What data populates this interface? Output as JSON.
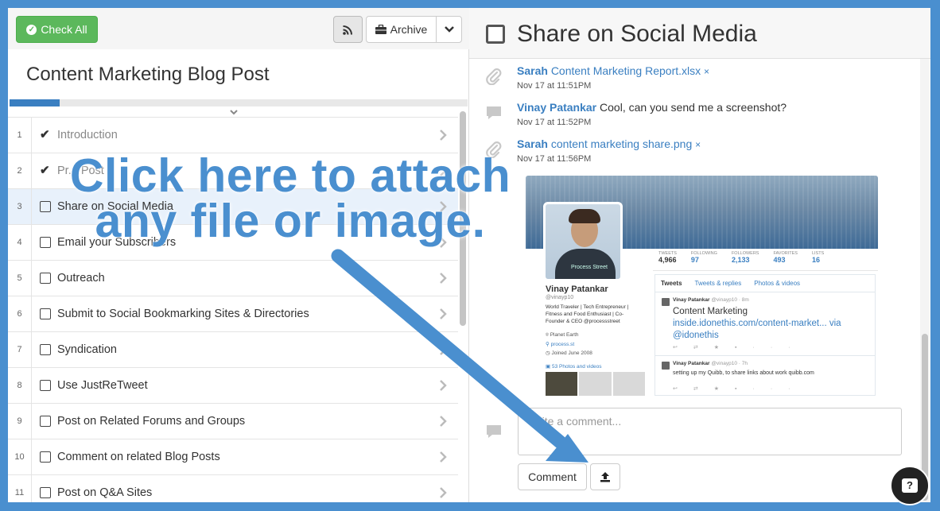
{
  "toolbar": {
    "check_all_label": "Check All",
    "archive_label": "Archive"
  },
  "checklist": {
    "title": "Content Marketing Blog Post",
    "progress": 0.11,
    "tasks": [
      {
        "num": "1",
        "label": "Introduction",
        "done": true
      },
      {
        "num": "2",
        "label": "Pr... Post",
        "done": true
      },
      {
        "num": "3",
        "label": "Share on Social Media",
        "done": false
      },
      {
        "num": "4",
        "label": "Email your Subscribers",
        "done": false
      },
      {
        "num": "5",
        "label": "Outreach",
        "done": false
      },
      {
        "num": "6",
        "label": "Submit to Social Bookmarking Sites & Directories",
        "done": false
      },
      {
        "num": "7",
        "label": "Syndication",
        "done": false
      },
      {
        "num": "8",
        "label": "Use JustReTweet",
        "done": false
      },
      {
        "num": "9",
        "label": "Post on Related Forums and Groups",
        "done": false
      },
      {
        "num": "10",
        "label": "Comment on related Blog Posts",
        "done": false
      },
      {
        "num": "11",
        "label": "Post on Q&A Sites",
        "done": false
      }
    ]
  },
  "task_detail": {
    "title": "Share on Social Media",
    "feed": [
      {
        "type": "attachment",
        "author": "Sarah",
        "text": "Content Marketing Report.xlsx",
        "remove": "×",
        "time": "Nov 17 at 11:51PM"
      },
      {
        "type": "comment",
        "author": "Vinay Patankar",
        "text": "Cool, can you send me a screenshot?",
        "time": "Nov 17 at 11:52PM"
      },
      {
        "type": "attachment",
        "author": "Sarah",
        "text": "content marketing share.png",
        "remove": "×",
        "time": "Nov 17 at 11:56PM"
      }
    ],
    "comment_placeholder": "Write a comment...",
    "comment_button": "Comment"
  },
  "preview": {
    "stats": [
      {
        "label": "TWEETS",
        "value": "4,966"
      },
      {
        "label": "FOLLOWING",
        "value": "97"
      },
      {
        "label": "FOLLOWERS",
        "value": "2,133"
      },
      {
        "label": "FAVORITES",
        "value": "493"
      },
      {
        "label": "LISTS",
        "value": "16"
      }
    ],
    "name": "Vinay Patankar",
    "handle": "@vinayp10",
    "bio": "World Traveler | Tech Entrepreneur | Fitness and Food Enthusiast | Co-Founder & CEO @processstreet",
    "location": "Planet Earth",
    "website": "process.st",
    "joined": "Joined June 2008",
    "photos": "53 Photos and videos",
    "tabs": [
      "Tweets",
      "Tweets & replies",
      "Photos & videos"
    ],
    "tweet1_head": "Vinay Patankar",
    "tweet1_meta": "@vinayp10 · 8m",
    "tweet1_l1": "Content Marketing",
    "tweet1_l2": "inside.idonethis.com/content-market... via",
    "tweet1_l3": "@idonethis",
    "tweet2_head": "Vinay Patankar",
    "tweet2_meta": "@vinayp10 · 7h",
    "tweet2_body": "setting up my Quibb, to share links about work quibb.com",
    "shirt_text": "Process Street"
  },
  "callout": {
    "line1": "Click here to attach",
    "line2": "any file or image."
  },
  "help": {
    "label": "?"
  },
  "colors": {
    "accent": "#4a8fcf",
    "success": "#5cb85c",
    "link": "#3a7fc1"
  }
}
